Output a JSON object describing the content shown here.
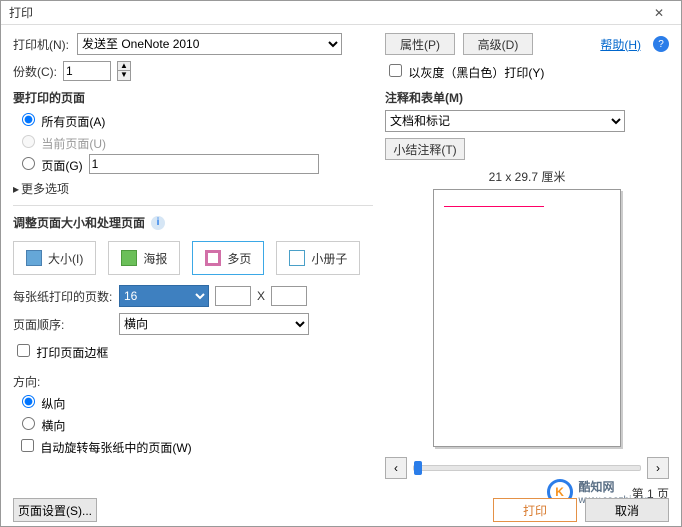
{
  "window": {
    "title": "打印",
    "close": "✕"
  },
  "topbar": {
    "printer_label": "打印机(N):",
    "printer_value": "发送至 OneNote 2010",
    "props_btn": "属性(P)",
    "adv_btn": "高级(D)",
    "help": "帮助(H)",
    "copies_label": "份数(C):",
    "copies_value": "1",
    "gray_label": "以灰度（黑白色）打印(Y)"
  },
  "pages": {
    "title": "要打印的页面",
    "all": "所有页面(A)",
    "current": "当前页面(U)",
    "range": "页面(G)",
    "range_value": "1",
    "more": "更多选项"
  },
  "sizing": {
    "title": "调整页面大小和处理页面",
    "tab_size": "大小(I)",
    "tab_poster": "海报",
    "tab_multi": "多页",
    "tab_book": "小册子",
    "pps_label": "每张纸打印的页数:",
    "pps_value": "16",
    "x": "X",
    "order_label": "页面顺序:",
    "order_value": "横向",
    "border_label": "打印页面边框"
  },
  "orient": {
    "label": "方向:",
    "portrait": "纵向",
    "landscape": "横向",
    "autorotate": "自动旋转每张纸中的页面(W)"
  },
  "comments": {
    "title": "注释和表单(M)",
    "value": "文档和标记",
    "summary_btn": "小结注释(T)"
  },
  "preview": {
    "caption": "21 x 29.7 厘米",
    "page_indicator": "第 1 页"
  },
  "footer": {
    "setup": "页面设置(S)...",
    "print": "打印",
    "cancel": "取消"
  },
  "logo": {
    "name": "酷知网",
    "url": "www.coozhi.com",
    "k": "K"
  }
}
